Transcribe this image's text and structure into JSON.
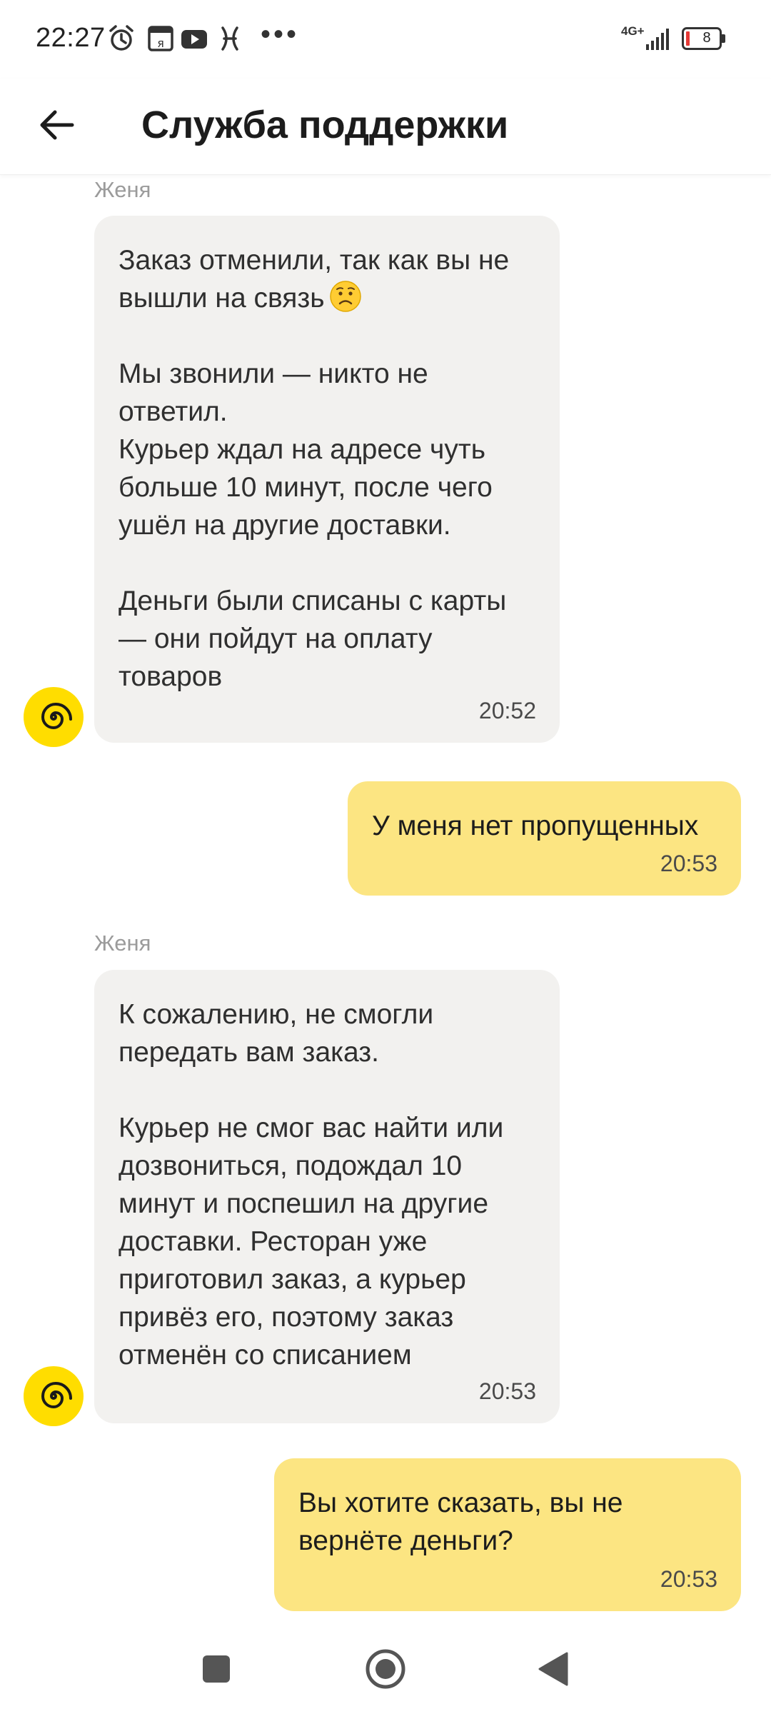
{
  "status_bar": {
    "time": "22:27",
    "network": "4G+",
    "battery": "8",
    "icons": [
      "alarm-icon",
      "yandex-app-icon",
      "youtube-icon",
      "app-notification-icon",
      "more-dots-icon",
      "signal-icon",
      "battery-icon"
    ]
  },
  "header": {
    "title": "Служба поддержки",
    "back_icon": "arrow-left-icon"
  },
  "messages": [
    {
      "direction": "incoming",
      "sender": "Женя",
      "text_before_emoji": "Заказ отменили, так как вы не\nвышли на связь",
      "emoji": "worried-face-emoji",
      "text_after_emoji": "\n\nМы звонили — никто не\nответил.\nКурьер ждал на адресе чуть\nбольше 10 минут, после чего\nушёл на другие доставки.\n\nДеньги были списаны с карты\n— они пойдут на оплату\nтоваров",
      "time": "20:52"
    },
    {
      "direction": "outgoing",
      "text": "У меня нет пропущенных",
      "time": "20:53"
    },
    {
      "direction": "incoming",
      "sender": "Женя",
      "text": "К сожалению, не смогли\nпередать вам заказ.\n\nКурьер не смог вас найти или\nдозвониться, подождал 10\nминут и поспешил на другие\nдоставки. Ресторан уже\nприготовил заказ, а курьер\nпривёз его, поэтому заказ\nотменён со списанием",
      "time": "20:53"
    },
    {
      "direction": "outgoing",
      "text": "Вы хотите сказать, вы не\nвернёте деньги?",
      "time": "20:53"
    }
  ],
  "nav_bar": {
    "buttons": [
      "recent-apps-icon",
      "home-icon",
      "back-triangle-icon"
    ]
  },
  "colors": {
    "incoming_bubble": "#f2f1ef",
    "outgoing_bubble": "#fce582",
    "avatar": "#ffdd00",
    "sender_name": "#9b9b9b"
  }
}
